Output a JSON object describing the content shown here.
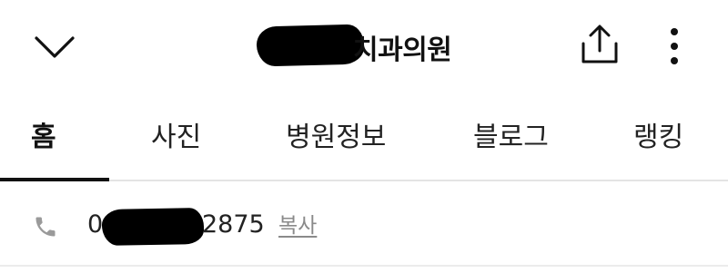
{
  "header": {
    "title_suffix": "치과의원",
    "icons": {
      "back": "chevron-down-icon",
      "share": "share-icon",
      "more": "more-vertical-icon"
    }
  },
  "tabs": [
    {
      "label": "홈",
      "active": true
    },
    {
      "label": "사진",
      "active": false
    },
    {
      "label": "병원정보",
      "active": false
    },
    {
      "label": "블로그",
      "active": false
    },
    {
      "label": "랭킹",
      "active": false
    }
  ],
  "phone": {
    "icon": "phone-icon",
    "prefix": "0",
    "suffix": "2875",
    "copy_label": "복사"
  },
  "colors": {
    "text": "#111111",
    "muted": "#8a8a8a",
    "icon_gray": "#9a9a9a",
    "divider": "#e4e4e4"
  }
}
